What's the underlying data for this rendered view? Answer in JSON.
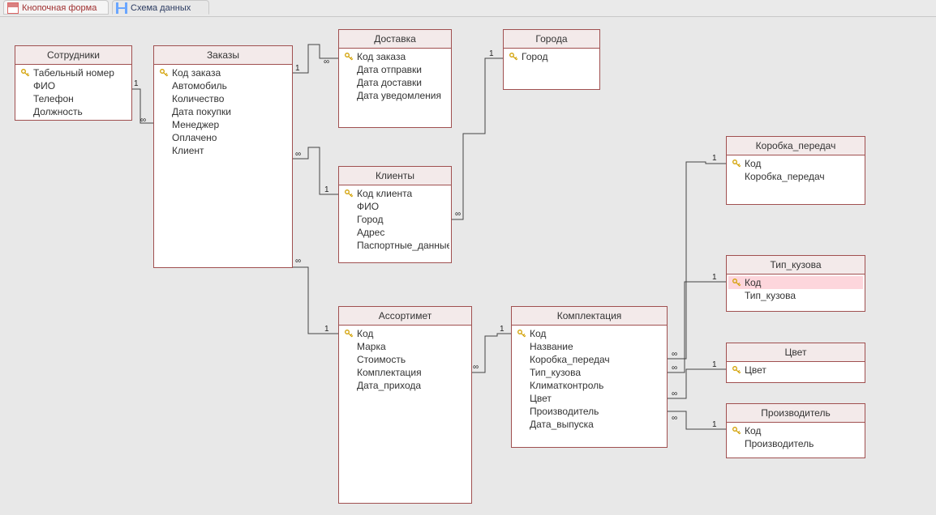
{
  "tabs": [
    {
      "label": "Кнопочная форма",
      "active": false
    },
    {
      "label": "Схема данных",
      "active": true
    }
  ],
  "tables": {
    "employees": {
      "title": "Сотрудники",
      "fields": [
        {
          "label": "Табельный номер",
          "pk": true
        },
        {
          "label": "ФИО",
          "pk": false
        },
        {
          "label": "Телефон",
          "pk": false
        },
        {
          "label": "Должность",
          "pk": false
        }
      ]
    },
    "orders": {
      "title": "Заказы",
      "fields": [
        {
          "label": "Код заказа",
          "pk": true
        },
        {
          "label": "Автомобиль",
          "pk": false
        },
        {
          "label": "Количество",
          "pk": false
        },
        {
          "label": "Дата покупки",
          "pk": false
        },
        {
          "label": "Менеджер",
          "pk": false
        },
        {
          "label": "Оплачено",
          "pk": false
        },
        {
          "label": "Клиент",
          "pk": false
        }
      ]
    },
    "delivery": {
      "title": "Доставка",
      "fields": [
        {
          "label": "Код заказа",
          "pk": true
        },
        {
          "label": "Дата отправки",
          "pk": false
        },
        {
          "label": "Дата доставки",
          "pk": false
        },
        {
          "label": "Дата уведомления",
          "pk": false
        }
      ]
    },
    "cities": {
      "title": "Города",
      "fields": [
        {
          "label": "Город",
          "pk": true
        }
      ]
    },
    "clients": {
      "title": "Клиенты",
      "fields": [
        {
          "label": "Код клиента",
          "pk": true
        },
        {
          "label": "ФИО",
          "pk": false
        },
        {
          "label": "Город",
          "pk": false
        },
        {
          "label": "Адрес",
          "pk": false
        },
        {
          "label": "Паспортные_данные",
          "pk": false
        }
      ]
    },
    "assortment": {
      "title": "Ассортимет",
      "fields": [
        {
          "label": "Код",
          "pk": true
        },
        {
          "label": "Марка",
          "pk": false
        },
        {
          "label": "Стоимость",
          "pk": false
        },
        {
          "label": "Комплектация",
          "pk": false
        },
        {
          "label": "Дата_прихода",
          "pk": false
        }
      ]
    },
    "spec": {
      "title": "Комплектация",
      "fields": [
        {
          "label": "Код",
          "pk": true
        },
        {
          "label": "Название",
          "pk": false
        },
        {
          "label": "Коробка_передач",
          "pk": false
        },
        {
          "label": "Тип_кузова",
          "pk": false
        },
        {
          "label": "Климатконтроль",
          "pk": false
        },
        {
          "label": "Цвет",
          "pk": false
        },
        {
          "label": "Производитель",
          "pk": false
        },
        {
          "label": "Дата_выпуска",
          "pk": false
        }
      ]
    },
    "gearbox": {
      "title": "Коробка_передач",
      "fields": [
        {
          "label": "Код",
          "pk": true
        },
        {
          "label": "Коробка_передач",
          "pk": false
        }
      ]
    },
    "bodytype": {
      "title": "Тип_кузова",
      "fields": [
        {
          "label": "Код",
          "pk": true,
          "highlight": true
        },
        {
          "label": "Тип_кузова",
          "pk": false
        }
      ]
    },
    "color": {
      "title": "Цвет",
      "fields": [
        {
          "label": "Цвет",
          "pk": true
        }
      ]
    },
    "manufacturer": {
      "title": "Производитель",
      "fields": [
        {
          "label": "Код",
          "pk": true
        },
        {
          "label": "Производитель",
          "pk": false
        }
      ]
    }
  },
  "labels": {
    "one": "1",
    "many": "∞"
  },
  "relationships": [
    {
      "from": "employees.Табельный номер",
      "to": "orders.Менеджер",
      "type": "1:∞"
    },
    {
      "from": "orders.Код заказа",
      "to": "delivery.Код заказа",
      "type": "1:∞"
    },
    {
      "from": "clients.Код клиента",
      "to": "orders.Клиент",
      "type": "1:∞"
    },
    {
      "from": "cities.Город",
      "to": "clients.Город",
      "type": "1:∞"
    },
    {
      "from": "assortment.Код",
      "to": "orders.Автомобиль",
      "type": "1:∞"
    },
    {
      "from": "spec.Код",
      "to": "assortment.Комплектация",
      "type": "1:∞"
    },
    {
      "from": "gearbox.Код",
      "to": "spec.Коробка_передач",
      "type": "1:∞"
    },
    {
      "from": "bodytype.Код",
      "to": "spec.Тип_кузова",
      "type": "1:∞"
    },
    {
      "from": "color.Цвет",
      "to": "spec.Цвет",
      "type": "1:∞"
    },
    {
      "from": "manufacturer.Код",
      "to": "spec.Производитель",
      "type": "1:∞"
    }
  ]
}
